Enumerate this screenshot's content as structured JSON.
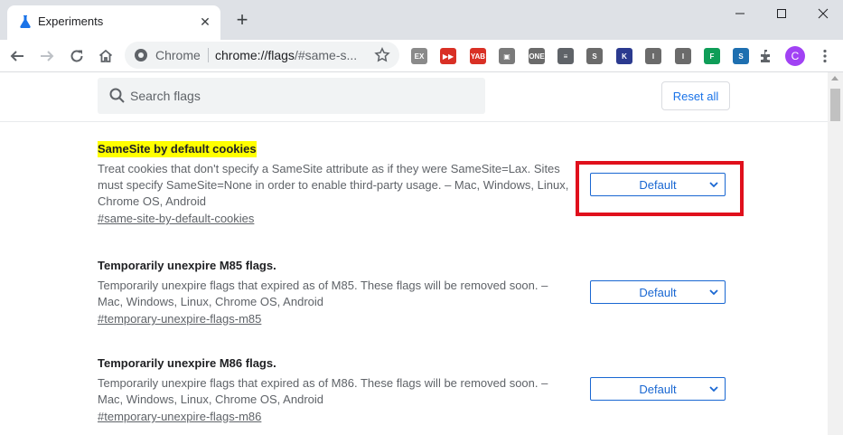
{
  "window": {
    "tab_title": "Experiments",
    "tab_icon": "flask-icon",
    "new_tab_icon": "plus-icon"
  },
  "toolbar": {
    "omnibox_label": "Chrome",
    "omnibox_url_main": "chrome://flags",
    "omnibox_url_rest": "/#same-s...",
    "extensions": [
      {
        "name": "ex-extension-icon",
        "text": "EX",
        "color": "#8a8a8a"
      },
      {
        "name": "record-extension-icon",
        "text": "▶▶",
        "color": "#d93025"
      },
      {
        "name": "yab-extension-icon",
        "text": "YAB",
        "color": "#d93025"
      },
      {
        "name": "screen-extension-icon",
        "text": "▣",
        "color": "#7a7a7a"
      },
      {
        "name": "one-extension-icon",
        "text": "ONE",
        "color": "#6b6b6b"
      },
      {
        "name": "list-extension-icon",
        "text": "≡",
        "color": "#5f6368"
      },
      {
        "name": "s-extension-icon",
        "text": "S",
        "color": "#6b6b6b"
      },
      {
        "name": "k-extension-icon",
        "text": "K",
        "color": "#2b3a8f"
      },
      {
        "name": "i-extension-icon",
        "text": "I",
        "color": "#6b6b6b"
      },
      {
        "name": "i2-extension-icon",
        "text": "I",
        "color": "#6b6b6b"
      },
      {
        "name": "f-extension-icon",
        "text": "F",
        "color": "#0f9d58"
      },
      {
        "name": "s2-extension-icon",
        "text": "S",
        "color": "#1e6fb0"
      }
    ],
    "profile_initial": "C",
    "profile_color": "#a142f4"
  },
  "flags_page": {
    "search_placeholder": "Search flags",
    "reset_label": "Reset all",
    "flags": [
      {
        "name": "SameSite by default cookies",
        "description": "Treat cookies that don't specify a SameSite attribute as if they were SameSite=Lax. Sites must specify SameSite=None in order to enable third-party usage. – Mac, Windows, Linux, Chrome OS, Android",
        "link": "#same-site-by-default-cookies",
        "value": "Default"
      },
      {
        "name": "Temporarily unexpire M85 flags.",
        "description": "Temporarily unexpire flags that expired as of M85. These flags will be removed soon. – Mac, Windows, Linux, Chrome OS, Android",
        "link": "#temporary-unexpire-flags-m85",
        "value": "Default"
      },
      {
        "name": "Temporarily unexpire M86 flags.",
        "description": "Temporarily unexpire flags that expired as of M86. These flags will be removed soon. – Mac, Windows, Linux, Chrome OS, Android",
        "link": "#temporary-unexpire-flags-m86",
        "value": "Default"
      }
    ]
  },
  "colors": {
    "highlight_box": "#e0101c",
    "flag_highlight": "#ffff00",
    "accent": "#1967d2"
  }
}
